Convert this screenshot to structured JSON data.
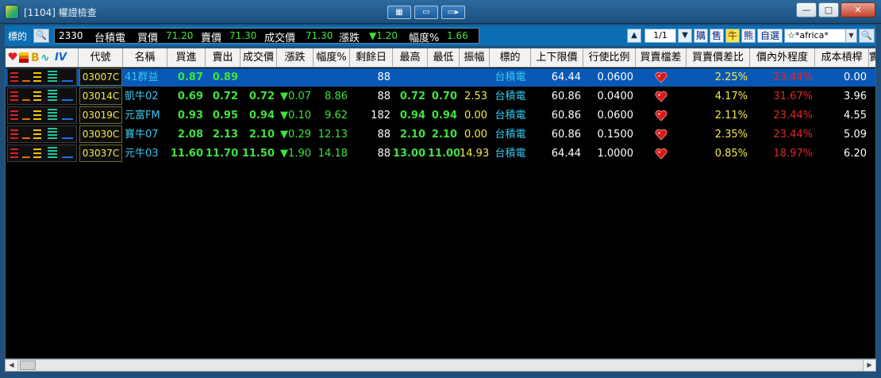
{
  "window": {
    "title": "[1104] 權證檢查",
    "controls": {
      "minimize": "—",
      "maximize": "□",
      "close": "✕"
    }
  },
  "toolbar": {
    "label": "標的",
    "stock_code": "2330",
    "stock_name": "台積電",
    "bid_label": "買價",
    "bid_value": "71.20",
    "ask_label": "賣價",
    "ask_value": "71.30",
    "last_label": "成交價",
    "last_value": "71.30",
    "change_label": "漲跌",
    "change_value": "▼1.20",
    "pct_label": "幅度%",
    "pct_value": "1.66",
    "page": "1/1",
    "chips": {
      "call": "購",
      "put": "售",
      "bull": "牛",
      "bear": "熊",
      "custom": "自選"
    },
    "select_value": "☆*africa*"
  },
  "columns": [
    {
      "key": "icons",
      "label": ""
    },
    {
      "key": "code",
      "label": "代號"
    },
    {
      "key": "name",
      "label": "名稱"
    },
    {
      "key": "bid",
      "label": "買進"
    },
    {
      "key": "ask",
      "label": "賣出"
    },
    {
      "key": "last",
      "label": "成交價"
    },
    {
      "key": "change",
      "label": "漲跌"
    },
    {
      "key": "pct",
      "label": "幅度%"
    },
    {
      "key": "days",
      "label": "剩餘日"
    },
    {
      "key": "high",
      "label": "最高"
    },
    {
      "key": "low",
      "label": "最低"
    },
    {
      "key": "amp",
      "label": "振幅"
    },
    {
      "key": "underlying",
      "label": "標的"
    },
    {
      "key": "limit",
      "label": "上下限價"
    },
    {
      "key": "ratio",
      "label": "行使比例"
    },
    {
      "key": "gap",
      "label": "買賣檔差"
    },
    {
      "key": "spread",
      "label": "買賣價差比"
    },
    {
      "key": "moneyness",
      "label": "價內外程度"
    },
    {
      "key": "leverage",
      "label": "成本槓桿"
    },
    {
      "key": "extra",
      "label": "實"
    }
  ],
  "header_icons": {
    "b_icon": "B",
    "iv_icon": "IV"
  },
  "rows": [
    {
      "code": "03007C",
      "name": "41群益",
      "bid": "0.87",
      "ask": "0.89",
      "last": "",
      "change": "",
      "pct": "",
      "days": "88",
      "high": "",
      "low": "",
      "amp": "",
      "underlying": "台積電",
      "limit": "64.44",
      "ratio": "0.0600",
      "spread": "2.25%",
      "moneyness": "23.44%",
      "leverage": "0.00",
      "selected": true
    },
    {
      "code": "03014C",
      "name": "凱牛02",
      "bid": "0.69",
      "ask": "0.72",
      "last": "0.72",
      "change": "▼0.07",
      "pct": "8.86",
      "days": "88",
      "high": "0.72",
      "low": "0.70",
      "amp": "2.53",
      "underlying": "台積電",
      "limit": "60.86",
      "ratio": "0.0400",
      "spread": "4.17%",
      "moneyness": "31.67%",
      "leverage": "3.96",
      "selected": false
    },
    {
      "code": "03019C",
      "name": "元富FM",
      "bid": "0.93",
      "ask": "0.95",
      "last": "0.94",
      "change": "▼0.10",
      "pct": "9.62",
      "days": "182",
      "high": "0.94",
      "low": "0.94",
      "amp": "0.00",
      "underlying": "台積電",
      "limit": "60.86",
      "ratio": "0.0600",
      "spread": "2.11%",
      "moneyness": "23.44%",
      "leverage": "4.55",
      "selected": false
    },
    {
      "code": "03030C",
      "name": "寶牛07",
      "bid": "2.08",
      "ask": "2.13",
      "last": "2.10",
      "change": "▼0.29",
      "pct": "12.13",
      "days": "88",
      "high": "2.10",
      "low": "2.10",
      "amp": "0.00",
      "underlying": "台積電",
      "limit": "60.86",
      "ratio": "0.1500",
      "spread": "2.35%",
      "moneyness": "23.44%",
      "leverage": "5.09",
      "selected": false
    },
    {
      "code": "03037C",
      "name": "元牛03",
      "bid": "11.60",
      "ask": "11.70",
      "last": "11.50",
      "change": "▼1.90",
      "pct": "14.18",
      "days": "88",
      "high": "13.00",
      "low": "11.00",
      "amp": "14.93",
      "underlying": "台積電",
      "limit": "64.44",
      "ratio": "1.0000",
      "spread": "0.85%",
      "moneyness": "18.97%",
      "leverage": "6.20",
      "selected": false
    }
  ],
  "colors": {
    "up": "#e02828",
    "down": "#3fe23f",
    "selected_row": "#0a58b5",
    "toolbar": "#0b6db2"
  }
}
